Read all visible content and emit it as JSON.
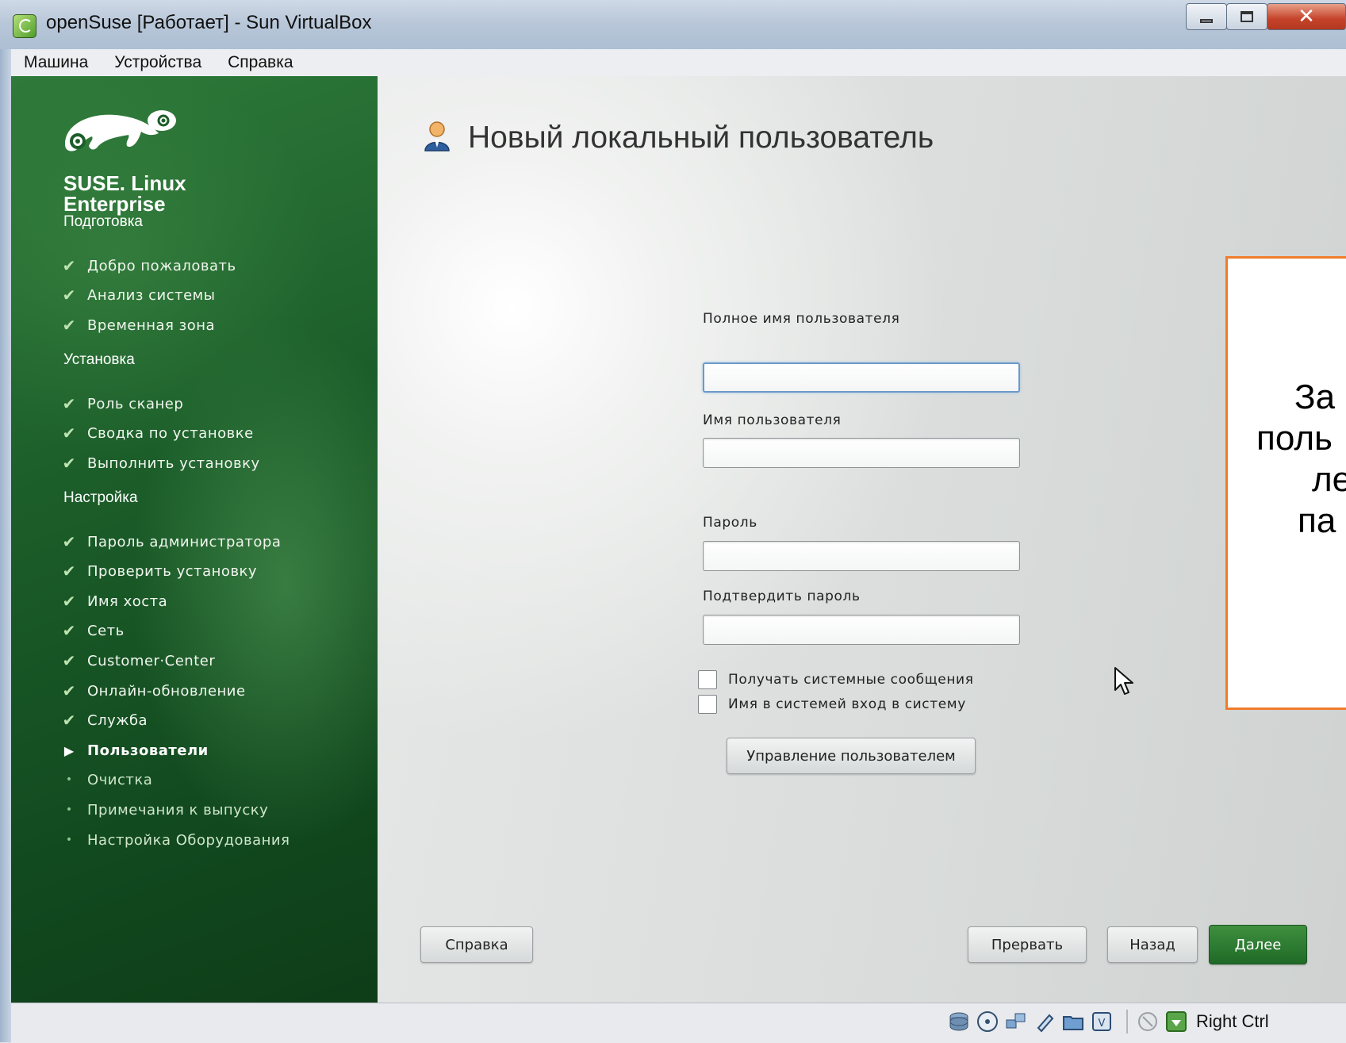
{
  "window": {
    "title": "openSuse [Работает] - Sun VirtualBox",
    "buttons": {
      "minimize": "minimize-icon",
      "maximize": "maximize-icon",
      "close": "✕"
    }
  },
  "menu": [
    "Машина",
    "Устройства",
    "Справка"
  ],
  "sidebar": {
    "brand_line1": "SUSE. Linux",
    "brand_line2": "Enterprise",
    "sections": [
      {
        "title": "Подготовка",
        "items": [
          {
            "label": "Добро пожаловать",
            "state": "done"
          },
          {
            "label": "Анализ системы",
            "state": "done"
          },
          {
            "label": "Временная зона",
            "state": "done"
          }
        ]
      },
      {
        "title": "Установка",
        "items": [
          {
            "label": "Роль сканер",
            "state": "done"
          },
          {
            "label": "Сводка по установке",
            "state": "done"
          },
          {
            "label": "Выполнить установку",
            "state": "done"
          }
        ]
      },
      {
        "title": "Настройка",
        "items": [
          {
            "label": "Пароль администратора",
            "state": "done"
          },
          {
            "label": "Проверить установку",
            "state": "done"
          },
          {
            "label": "Имя хоста",
            "state": "done"
          },
          {
            "label": "Сеть",
            "state": "done"
          },
          {
            "label": "Customer·Center",
            "state": "done"
          },
          {
            "label": "Онлайн-обновление",
            "state": "done"
          },
          {
            "label": "Служба",
            "state": "done"
          },
          {
            "label": "Пользователи",
            "state": "current"
          },
          {
            "label": "Очистка",
            "state": "pending"
          },
          {
            "label": "Примечания к выпуску",
            "state": "pending"
          },
          {
            "label": "Настройка Оборудования",
            "state": "pending"
          }
        ]
      }
    ]
  },
  "main": {
    "title": "Новый локальный пользователь",
    "fields": {
      "full_name_label": "Полное имя пользователя",
      "full_name_value": "",
      "username_label": "Имя пользователя",
      "username_value": "",
      "password_label": "Пароль",
      "password_value": "",
      "confirm_label": "Подтвердить пароль",
      "confirm_value": ""
    },
    "checkboxes": {
      "receive_messages": "Получать системные сообщения",
      "auto_login": "Имя в системей вход в систему"
    },
    "manage_button": "Управление пользователем",
    "buttons": {
      "help": "Справка",
      "abort": "Прервать",
      "back": "Назад",
      "next": "Далее"
    }
  },
  "callout": {
    "lines": [
      "За",
      "поль",
      "ле",
      "па"
    ]
  },
  "statusbar": {
    "host_key": "Right Ctrl"
  },
  "colors": {
    "accent_green": "#1f6a27",
    "callout_border": "#f07b2a"
  }
}
